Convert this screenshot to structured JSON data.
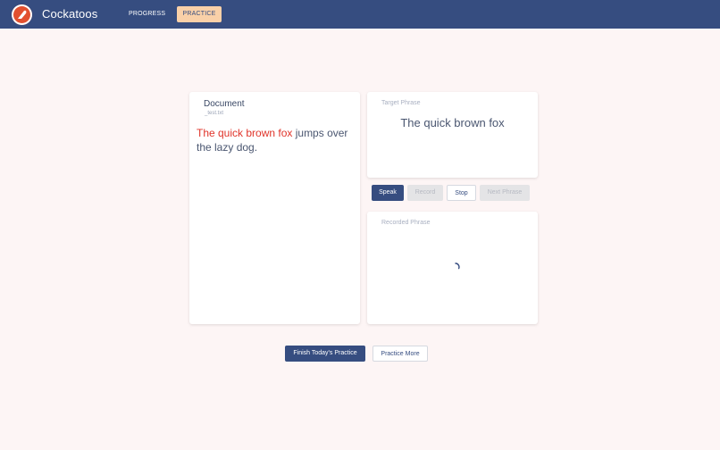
{
  "header": {
    "app_name": "Cockatoos",
    "logo_icon": "cockatoo-logo-icon",
    "brand_color": "#364d80",
    "nav": {
      "progress": "PROGRESS",
      "practice": "PRACTICE"
    },
    "active_tab": "practice"
  },
  "document": {
    "title": "Document",
    "filename": "_test.txt",
    "highlighted_text": "The quick brown fox",
    "remaining_text": " jumps over the lazy dog.",
    "highlight_color": "#e0342a"
  },
  "target": {
    "label": "Target Phrase",
    "phrase": "The quick brown fox"
  },
  "controls": {
    "speak": "Speak",
    "record": "Record",
    "stop": "Stop",
    "next": "Next Phrase"
  },
  "recorded": {
    "label": "Recorded Phrase",
    "status_icon": "loading-spinner-icon"
  },
  "footer": {
    "finish": "Finish Today's Practice",
    "more": "Practice More"
  }
}
